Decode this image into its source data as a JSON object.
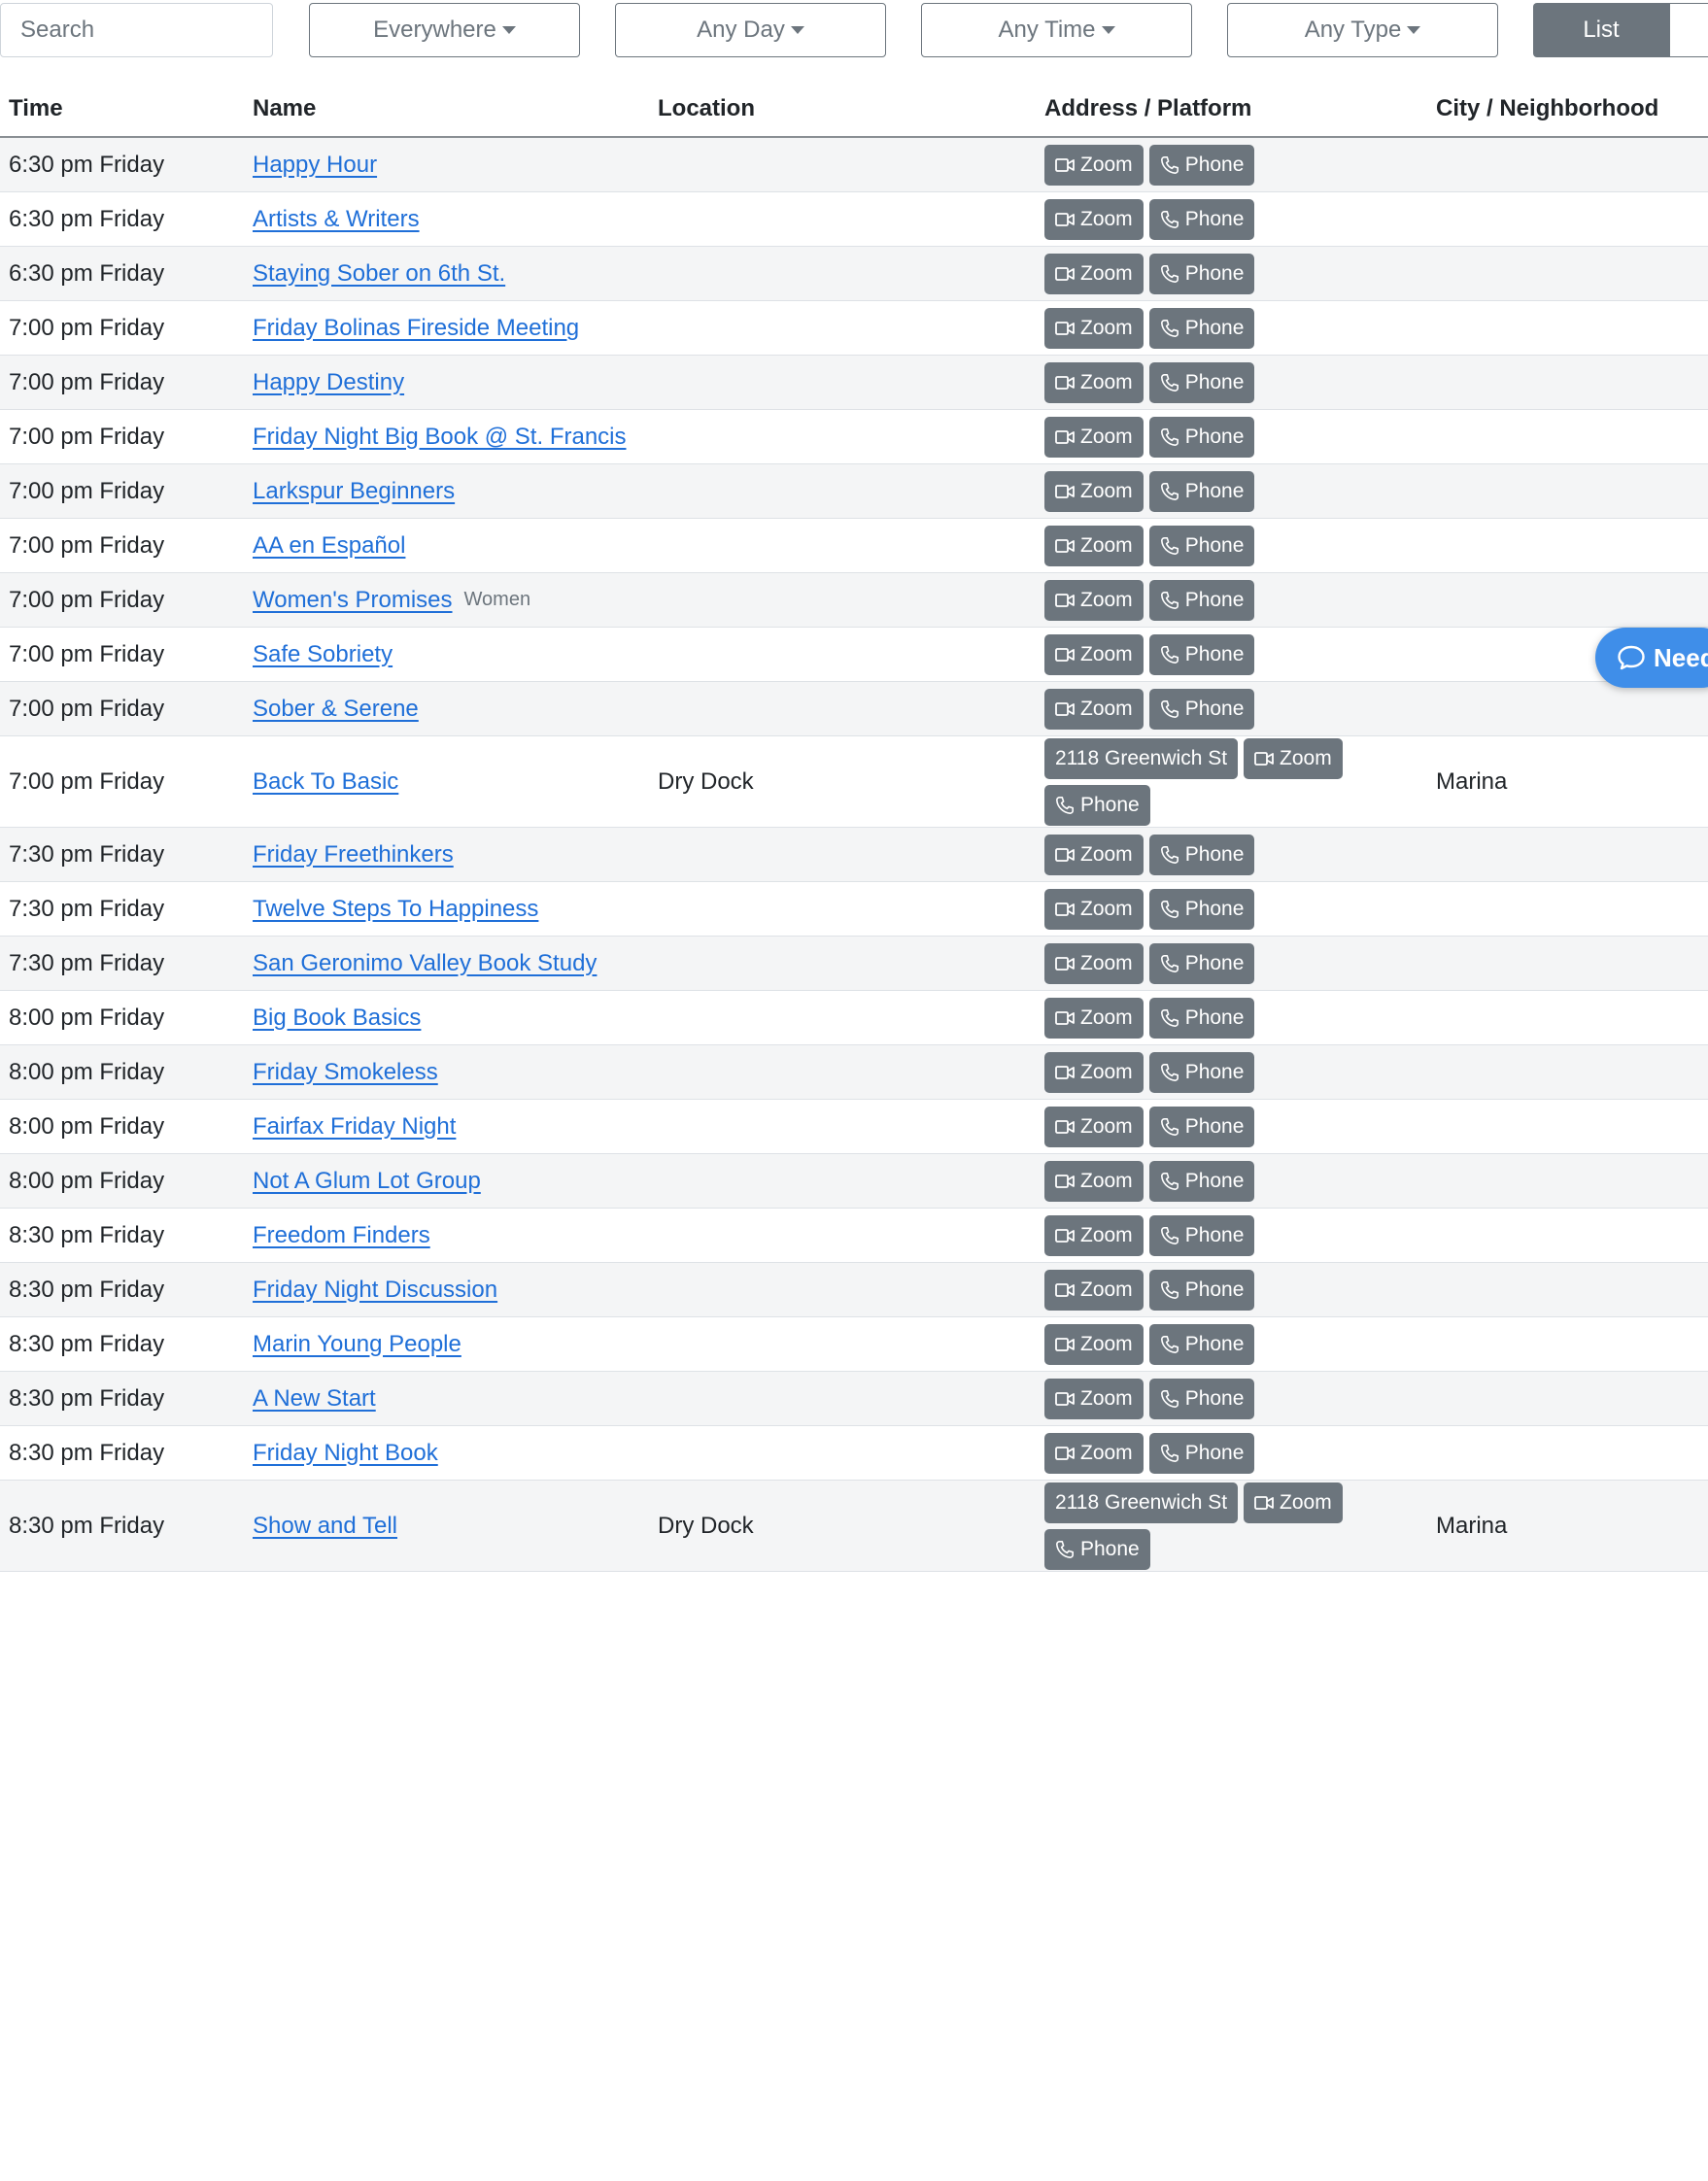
{
  "filters": {
    "search_placeholder": "Search",
    "region": "Everywhere",
    "day": "Any Day",
    "time": "Any Time",
    "type": "Any Type",
    "view_list": "List"
  },
  "table": {
    "headers": {
      "time": "Time",
      "name": "Name",
      "location": "Location",
      "address": "Address / Platform",
      "city": "City / Neighborhood"
    },
    "rows": [
      {
        "time": "6:30 pm Friday",
        "name": "Happy Hour",
        "tag": "",
        "location": "",
        "address": "",
        "city": ""
      },
      {
        "time": "6:30 pm Friday",
        "name": "Artists & Writers",
        "tag": "",
        "location": "",
        "address": "",
        "city": ""
      },
      {
        "time": "6:30 pm Friday",
        "name": "Staying Sober on 6th St.",
        "tag": "",
        "location": "",
        "address": "",
        "city": ""
      },
      {
        "time": "7:00 pm Friday",
        "name": "Friday Bolinas Fireside Meeting",
        "tag": "",
        "location": "",
        "address": "",
        "city": ""
      },
      {
        "time": "7:00 pm Friday",
        "name": "Happy Destiny",
        "tag": "",
        "location": "",
        "address": "",
        "city": ""
      },
      {
        "time": "7:00 pm Friday",
        "name": "Friday Night Big Book @ St. Francis",
        "tag": "",
        "location": "",
        "address": "",
        "city": ""
      },
      {
        "time": "7:00 pm Friday",
        "name": "Larkspur Beginners",
        "tag": "",
        "location": "",
        "address": "",
        "city": ""
      },
      {
        "time": "7:00 pm Friday",
        "name": "AA en Español",
        "tag": "",
        "location": "",
        "address": "",
        "city": ""
      },
      {
        "time": "7:00 pm Friday",
        "name": "Women's Promises",
        "tag": "Women",
        "location": "",
        "address": "",
        "city": ""
      },
      {
        "time": "7:00 pm Friday",
        "name": "Safe Sobriety",
        "tag": "",
        "location": "",
        "address": "",
        "city": ""
      },
      {
        "time": "7:00 pm Friday",
        "name": "Sober & Serene",
        "tag": "",
        "location": "",
        "address": "",
        "city": ""
      },
      {
        "time": "7:00 pm Friday",
        "name": "Back To Basic",
        "tag": "",
        "location": "Dry Dock",
        "address": "2118 Greenwich St",
        "city": "Marina"
      },
      {
        "time": "7:30 pm Friday",
        "name": "Friday Freethinkers",
        "tag": "",
        "location": "",
        "address": "",
        "city": ""
      },
      {
        "time": "7:30 pm Friday",
        "name": "Twelve Steps To Happiness",
        "tag": "",
        "location": "",
        "address": "",
        "city": ""
      },
      {
        "time": "7:30 pm Friday",
        "name": "San Geronimo Valley Book Study",
        "tag": "",
        "location": "",
        "address": "",
        "city": ""
      },
      {
        "time": "8:00 pm Friday",
        "name": "Big Book Basics",
        "tag": "",
        "location": "",
        "address": "",
        "city": ""
      },
      {
        "time": "8:00 pm Friday",
        "name": "Friday Smokeless",
        "tag": "",
        "location": "",
        "address": "",
        "city": ""
      },
      {
        "time": "8:00 pm Friday",
        "name": "Fairfax Friday Night",
        "tag": "",
        "location": "",
        "address": "",
        "city": ""
      },
      {
        "time": "8:00 pm Friday",
        "name": "Not A Glum Lot Group",
        "tag": "",
        "location": "",
        "address": "",
        "city": ""
      },
      {
        "time": "8:30 pm Friday",
        "name": "Freedom Finders",
        "tag": "",
        "location": "",
        "address": "",
        "city": ""
      },
      {
        "time": "8:30 pm Friday",
        "name": "Friday Night Discussion",
        "tag": "",
        "location": "",
        "address": "",
        "city": ""
      },
      {
        "time": "8:30 pm Friday",
        "name": "Marin Young People",
        "tag": "",
        "location": "",
        "address": "",
        "city": ""
      },
      {
        "time": "8:30 pm Friday",
        "name": "A New Start",
        "tag": "",
        "location": "",
        "address": "",
        "city": ""
      },
      {
        "time": "8:30 pm Friday",
        "name": "Friday Night Book",
        "tag": "",
        "location": "",
        "address": "",
        "city": ""
      },
      {
        "time": "8:30 pm Friday",
        "name": "Show and Tell",
        "tag": "",
        "location": "Dry Dock",
        "address": "2118 Greenwich St",
        "city": "Marina"
      }
    ]
  },
  "platform_labels": {
    "zoom": "Zoom",
    "phone": "Phone"
  },
  "chat_widget": {
    "label": "Need"
  },
  "icons": {
    "zoom": "video-camera-icon",
    "phone": "phone-icon",
    "chat": "chat-bubble-icon",
    "dropdown": "caret-down-icon"
  },
  "colors": {
    "badge": "#6c757d",
    "link": "#1f6fd8",
    "chat": "#3f8ee9",
    "stripe": "#f4f5f6"
  }
}
